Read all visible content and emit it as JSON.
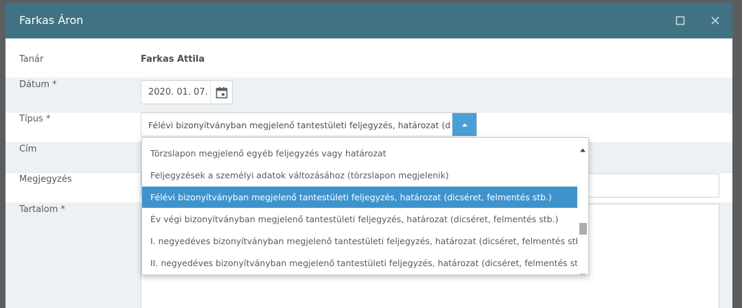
{
  "window": {
    "title": "Farkas Áron",
    "maximize_icon": "maximize-icon",
    "close_icon": "close-icon",
    "header_color": "#417283"
  },
  "form": {
    "teacher": {
      "label": "Tanár",
      "value": "Farkas Attila"
    },
    "date": {
      "label": "Dátum *",
      "value": "2020. 01. 07.",
      "icon": "calendar-icon"
    },
    "type": {
      "label": "Típus *",
      "value": "Félévi bizonyítványban megjelenő tantestületi feljegyzés, határozat (dicsé",
      "icon": "chevron-up-icon"
    },
    "subject": {
      "label": "Cím"
    },
    "note": {
      "label": "Megjegyzés"
    },
    "content": {
      "label": "Tartalom *"
    }
  },
  "dropdown": {
    "options": [
      "Törzslapon megjelenő egyéb feljegyzés vagy határozat",
      "Feljegyzések a személyi adatok változásához (törzslapon megjelenik)",
      "Félévi bizonyítványban megjelenő tantestületi feljegyzés, határozat (dicséret, felmentés stb.)",
      "Év végi bizonyítványban megjelenő tantestületi feljegyzés, határozat (dicséret, felmentés stb.)",
      "I. negyedéves bizonyítványban megjelenő tantestületi feljegyzés, határozat (dicséret, felmentés stb.)",
      "II. negyedéves bizonyítványban megjelenő tantestületi feljegyzés, határozat (dicséret, felmentés stb.)"
    ],
    "selected_index": 2,
    "highlight_color": "#3e93cd"
  }
}
